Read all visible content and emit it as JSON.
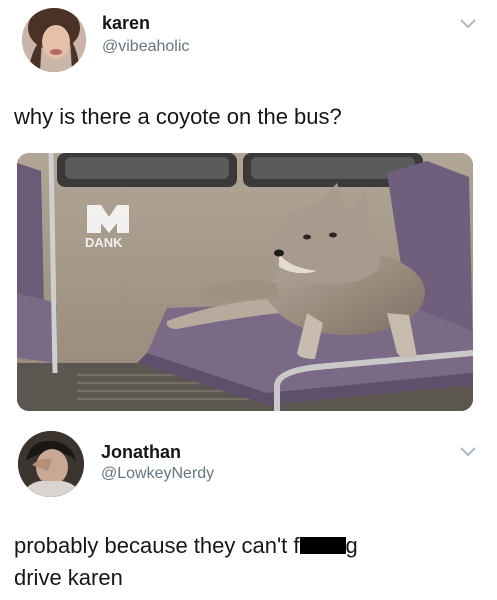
{
  "tweet": {
    "author_name": "karen",
    "author_handle": "@vibeaholic",
    "text": "why is there a coyote on the bus?",
    "media": {
      "watermark_label": "DANK"
    }
  },
  "reply": {
    "author_name": "Jonathan",
    "author_handle": "@LowkeyNerdy",
    "text_part1": "probably because they can't f",
    "text_part2": "g",
    "text_line2": "drive karen"
  },
  "icons": {
    "more": "chevron-down-icon",
    "watermark": "dank-logo-icon"
  },
  "colors": {
    "handle": "#66757f",
    "text": "#14171a",
    "seat": "#7b6a86",
    "censor": "#000000"
  }
}
